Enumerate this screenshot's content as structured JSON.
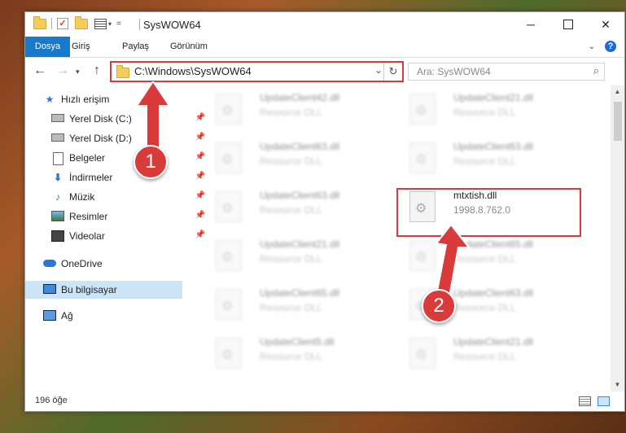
{
  "window": {
    "title": "SysWOW64"
  },
  "ribbon": {
    "tabs": [
      "Dosya",
      "Giriş",
      "Paylaş",
      "Görünüm"
    ]
  },
  "nav": {
    "path": "C:\\Windows\\SysWOW64",
    "search_placeholder": "Ara: SysWOW64"
  },
  "sidebar": {
    "items": [
      {
        "label": "Hızlı erişim"
      },
      {
        "label": "Yerel Disk (C:)"
      },
      {
        "label": "Yerel Disk (D:)"
      },
      {
        "label": "Belgeler"
      },
      {
        "label": "İndirmeler"
      },
      {
        "label": "Müzik"
      },
      {
        "label": "Resimler"
      },
      {
        "label": "Videolar"
      },
      {
        "label": "OneDrive"
      },
      {
        "label": "Bu bilgisayar"
      },
      {
        "label": "Ağ"
      }
    ]
  },
  "files": [
    {
      "name": "UpdateClient42.dll",
      "sub": "Resource DLL"
    },
    {
      "name": "UpdateClient21.dll",
      "sub": "Resource DLL"
    },
    {
      "name": "UpdateClient63.dll",
      "sub": "Resource DLL"
    },
    {
      "name": "UpdateClient63.dll",
      "sub": "Resource DLL"
    },
    {
      "name": "UpdateClient63.dll",
      "sub": "Resource DLL"
    },
    {
      "name": "mtxtish.dll",
      "sub": "1998.8.762.0"
    },
    {
      "name": "UpdateClient21.dll",
      "sub": "Resource DLL"
    },
    {
      "name": "UpdateClient65.dll",
      "sub": "Resource DLL"
    },
    {
      "name": "UpdateClient65.dll",
      "sub": "Resource DLL"
    },
    {
      "name": "UpdateClient63.dll",
      "sub": "Resource DLL"
    },
    {
      "name": "UpdateClient5.dll",
      "sub": "Resource DLL"
    },
    {
      "name": "UpdateClient21.dll",
      "sub": "Resource DLL"
    }
  ],
  "status": {
    "count": "196 öğe"
  },
  "annotations": {
    "step1": "1",
    "step2": "2"
  },
  "colors": {
    "accent": "#1979ca",
    "annotation_red": "#d93a3a",
    "selected": "#cce4f7"
  }
}
